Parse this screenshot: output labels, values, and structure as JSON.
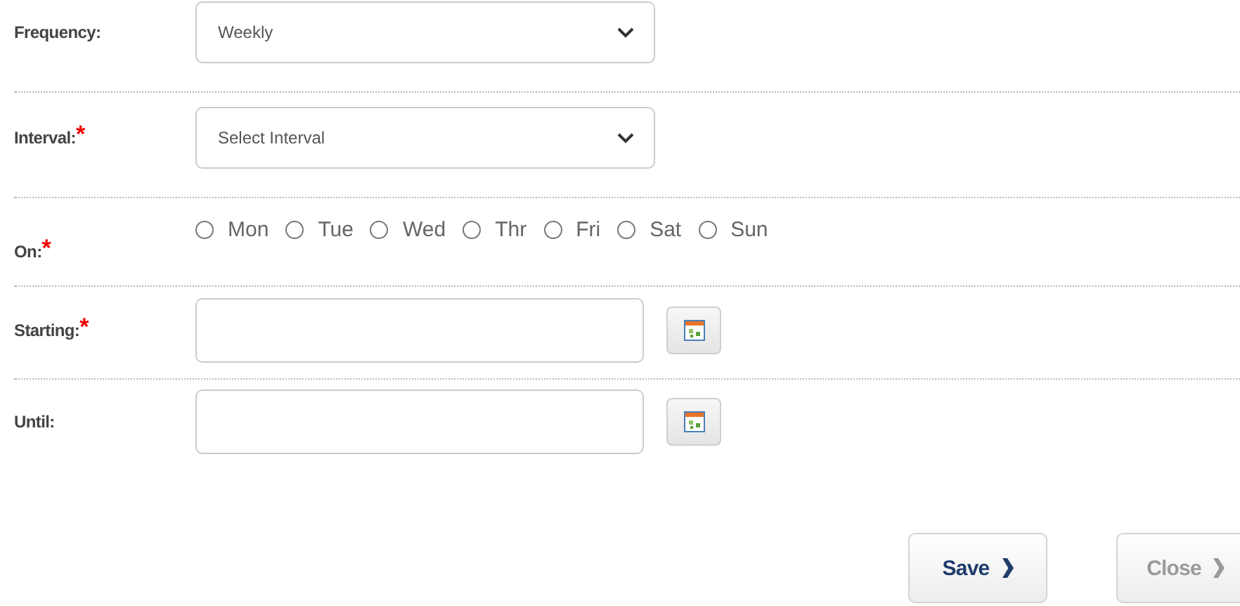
{
  "fields": [
    {
      "kind": "select",
      "label": "Frequency:",
      "value": "Weekly"
    },
    {
      "kind": "select",
      "label": "Interval:",
      "required_mark": "*",
      "placeholder": "Select Interval"
    },
    {
      "kind": "radios",
      "label": "On:",
      "required_mark": "*",
      "options": [
        {
          "label": "Mon",
          "selected": false
        },
        {
          "label": "Tue",
          "selected": false
        },
        {
          "label": "Wed",
          "selected": false
        },
        {
          "label": "Thr",
          "selected": false
        },
        {
          "label": "Fri",
          "selected": false
        },
        {
          "label": "Sat",
          "selected": false
        },
        {
          "label": "Sun",
          "selected": false
        }
      ]
    },
    {
      "kind": "date",
      "label": "Starting:",
      "required_mark": "*"
    },
    {
      "kind": "date",
      "label": "Until:"
    }
  ],
  "buttons": [
    {
      "label": "Save",
      "disabled": false
    },
    {
      "label": "Close",
      "disabled": true
    }
  ]
}
